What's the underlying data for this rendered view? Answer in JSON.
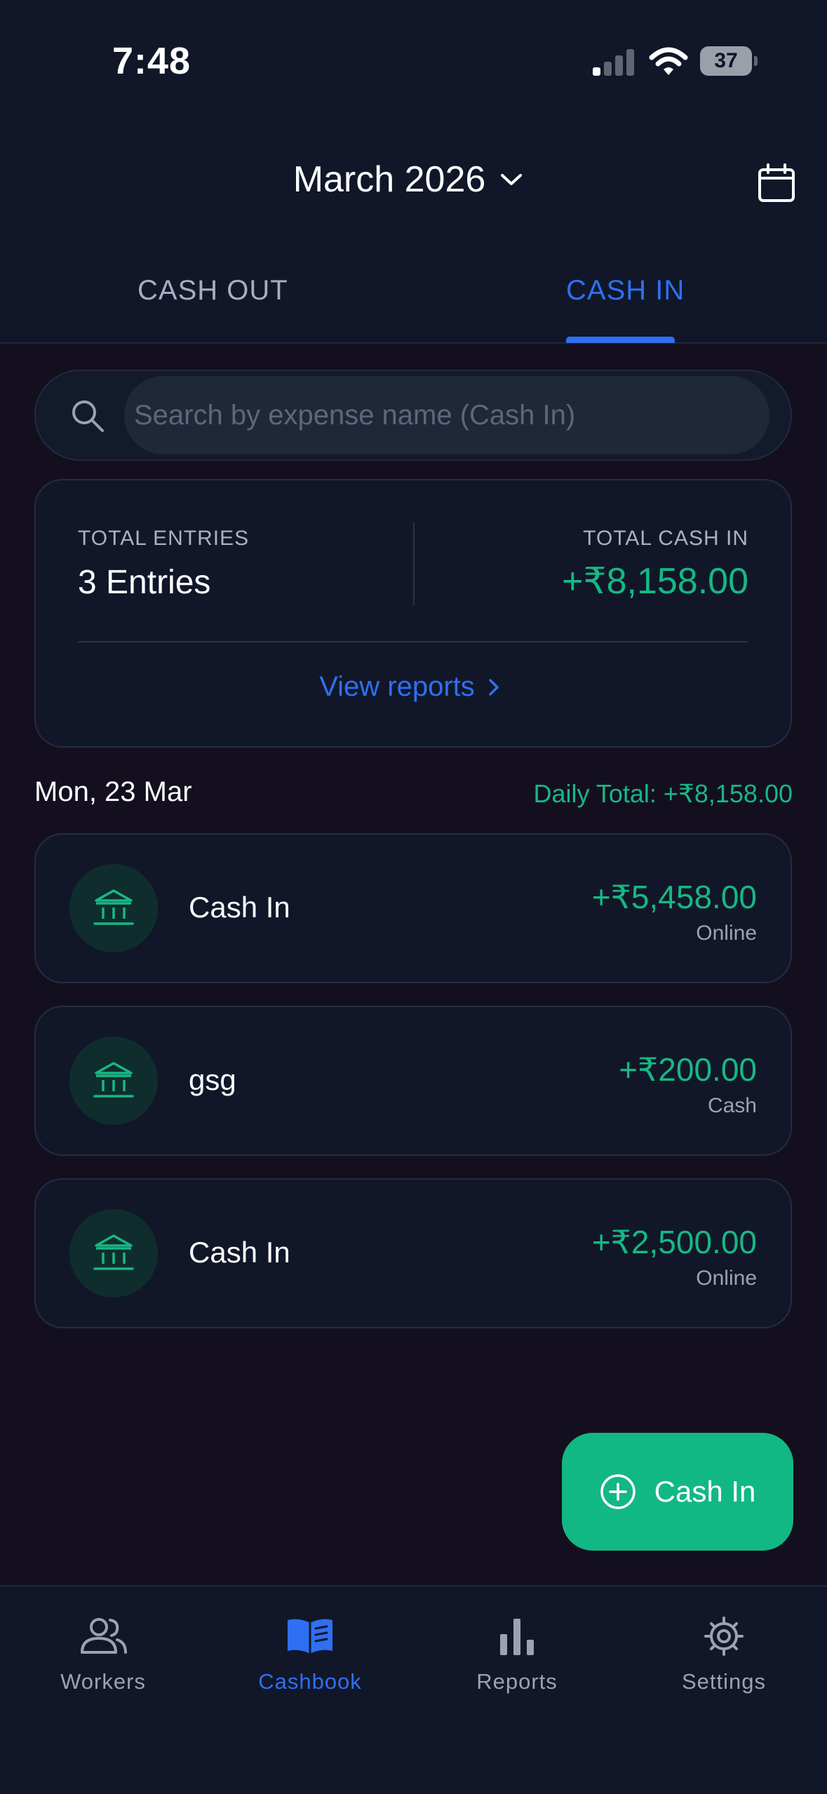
{
  "status_bar": {
    "time": "7:48",
    "battery": "37"
  },
  "header": {
    "month": "March 2026"
  },
  "tabs": [
    {
      "label": "CASH OUT",
      "active": false
    },
    {
      "label": "CASH IN",
      "active": true
    }
  ],
  "search": {
    "placeholder": "Search by expense name (Cash In)"
  },
  "summary": {
    "entries_label": "TOTAL ENTRIES",
    "entries_value": "3 Entries",
    "total_label": "TOTAL CASH IN",
    "total_value": "+₹8,158.00",
    "view_reports": "View reports"
  },
  "day": {
    "date": "Mon, 23 Mar",
    "daily_total": "Daily Total: +₹8,158.00"
  },
  "entries": [
    {
      "name": "Cash In",
      "amount": "+₹5,458.00",
      "method": "Online"
    },
    {
      "name": "gsg",
      "amount": "+₹200.00",
      "method": "Cash"
    },
    {
      "name": "Cash In",
      "amount": "+₹2,500.00",
      "method": "Online"
    }
  ],
  "fab": {
    "label": "Cash In"
  },
  "nav": [
    {
      "label": "Workers",
      "icon": "workers-icon"
    },
    {
      "label": "Cashbook",
      "icon": "cashbook-icon",
      "active": true
    },
    {
      "label": "Reports",
      "icon": "reports-icon"
    },
    {
      "label": "Settings",
      "icon": "settings-icon"
    }
  ],
  "colors": {
    "accent_blue": "#2f6ff2",
    "accent_green": "#17b883",
    "background": "#140f1f",
    "card": "#111729"
  }
}
